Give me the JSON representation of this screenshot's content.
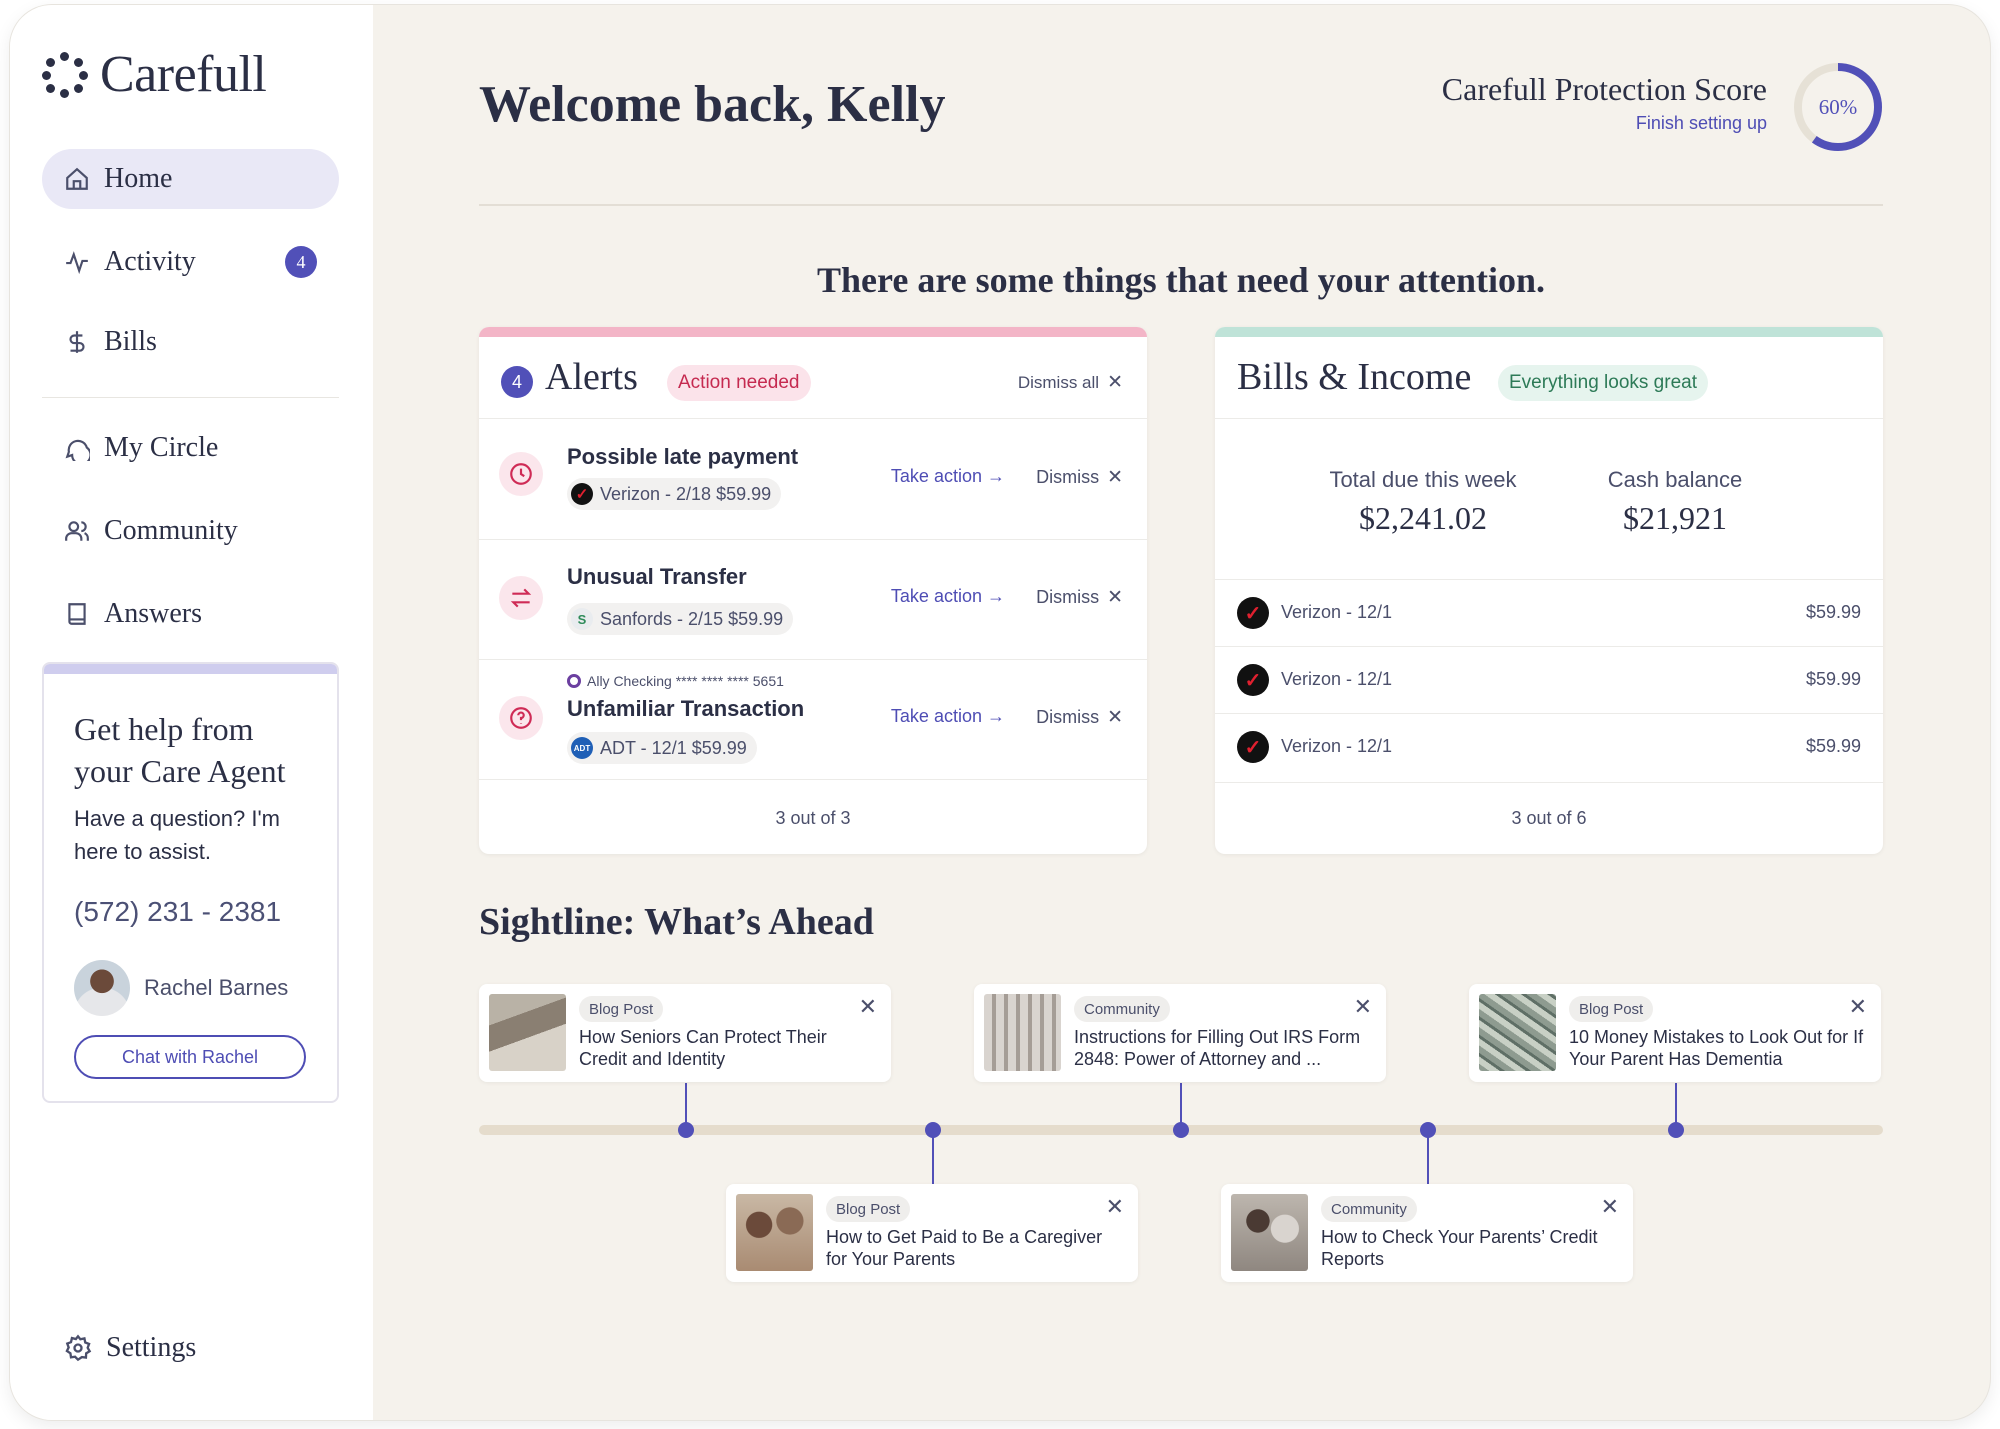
{
  "app": {
    "brand": "Carefull"
  },
  "sidebar": {
    "items": [
      {
        "label": "Home",
        "icon": "home-icon",
        "active": true
      },
      {
        "label": "Activity",
        "icon": "activity-icon",
        "badge": "4"
      },
      {
        "label": "Bills",
        "icon": "dollar-icon"
      },
      {
        "label": "My Circle",
        "icon": "chat-bubble-icon"
      },
      {
        "label": "Community",
        "icon": "users-icon"
      },
      {
        "label": "Answers",
        "icon": "book-icon"
      }
    ],
    "agent": {
      "title_line1": "Get help from",
      "title_line2": "your Care Agent",
      "description": "Have a question? I'm here to assist.",
      "phone": "(572) 231 - 2381",
      "name": "Rachel Barnes",
      "chat_label": "Chat with Rachel"
    },
    "settings_label": "Settings"
  },
  "header": {
    "welcome": "Welcome back, Kelly",
    "score_title": "Carefull Protection Score",
    "score_link": "Finish setting up",
    "score_value": "60%",
    "score_fraction": 0.6
  },
  "attention_title": "There are some things that need your attention.",
  "alerts": {
    "count": "4",
    "title": "Alerts",
    "status": "Action needed",
    "dismiss_all": "Dismiss all",
    "take_action": "Take action",
    "dismiss": "Dismiss",
    "items": [
      {
        "title": "Possible late payment",
        "meta": "Verizon - 2/18 $59.99",
        "brand_glyph": "✓",
        "icon": "clock-icon"
      },
      {
        "title": "Unusual Transfer",
        "meta": "Sanfords - 2/15 $59.99",
        "brand_glyph": "S",
        "icon": "transfer-icon"
      },
      {
        "title": "Unfamiliar Transaction",
        "meta": "ADT - 12/1 $59.99",
        "brand_glyph": "ADT",
        "account": "Ally Checking **** **** **** 5651",
        "icon": "question-icon"
      }
    ],
    "footer": "3 out of 3"
  },
  "bills": {
    "title": "Bills & Income",
    "status": "Everything looks great",
    "total_label": "Total due this week",
    "total_value": "$2,241.02",
    "cash_label": "Cash balance",
    "cash_value": "$21,921",
    "rows": [
      {
        "name": "Verizon - 12/1",
        "amount": "$59.99"
      },
      {
        "name": "Verizon - 12/1",
        "amount": "$59.99"
      },
      {
        "name": "Verizon - 12/1",
        "amount": "$59.99"
      }
    ],
    "footer": "3 out of 6"
  },
  "sightline": {
    "title": "Sightline: What’s Ahead",
    "cards": [
      {
        "tag": "Blog Post",
        "text": "How Seniors Can Protect Their Credit and Identity"
      },
      {
        "tag": "Blog Post",
        "text": "How to Get Paid to Be a Caregiver for Your Parents"
      },
      {
        "tag": "Community",
        "text": "Instructions for Filling Out IRS Form 2848: Power of Attorney and ..."
      },
      {
        "tag": "Community",
        "text": "How to Check Your Parents’ Credit Reports"
      },
      {
        "tag": "Blog Post",
        "text": "10 Money Mistakes to Look Out for If Your Parent Has Dementia"
      }
    ]
  },
  "colors": {
    "accent": "#5150b8",
    "alert_pink": "#f3b5c7",
    "income_mint": "#bfe3d8",
    "background": "#f5f2ec"
  }
}
